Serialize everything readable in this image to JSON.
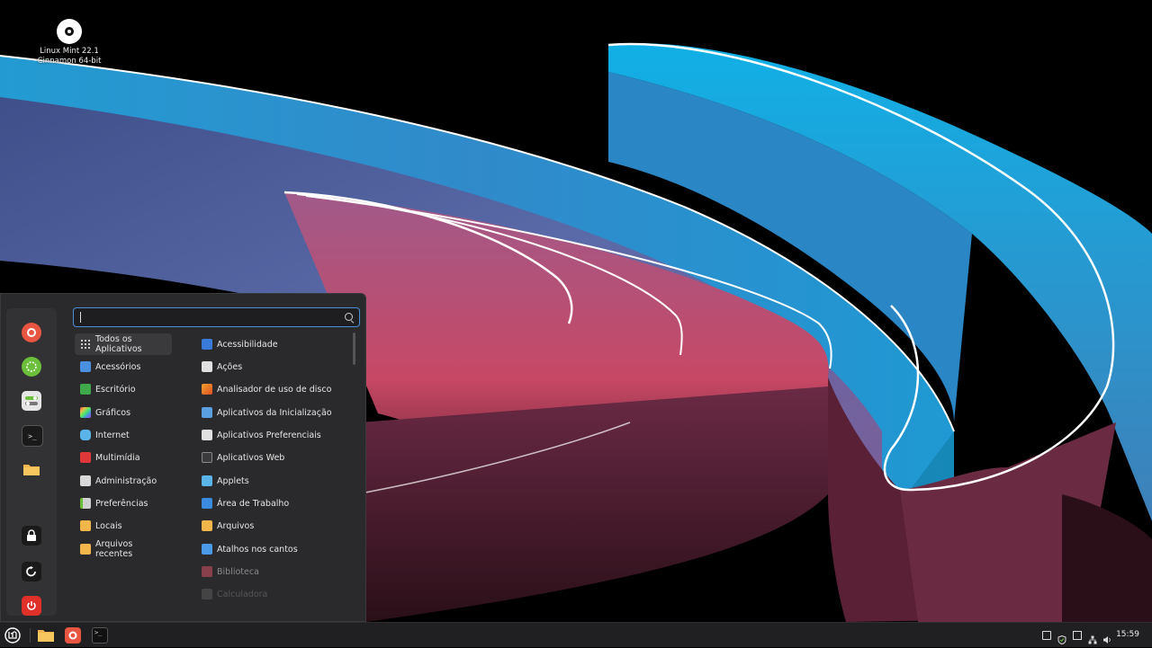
{
  "desktop": {
    "icon_line1": "Linux Mint 22.1",
    "icon_line2": "Cinnamon 64-bit"
  },
  "menu": {
    "search": {
      "value": "",
      "placeholder": ""
    },
    "favorites": [
      {
        "name": "firefox",
        "icon": "firefox-icon"
      },
      {
        "name": "software-manager",
        "icon": "mint-software-icon"
      },
      {
        "name": "settings",
        "icon": "toggles-icon"
      },
      {
        "name": "terminal",
        "icon": "terminal-icon"
      },
      {
        "name": "files",
        "icon": "folder-icon"
      },
      {
        "name": "lock",
        "icon": "lock-icon"
      },
      {
        "name": "logout",
        "icon": "logout-icon"
      },
      {
        "name": "shutdown",
        "icon": "power-icon"
      }
    ],
    "categories": [
      {
        "label": "Todos os Aplicativos",
        "icon": "grid-icon"
      },
      {
        "label": "Acessórios",
        "icon": "accessories-icon"
      },
      {
        "label": "Escritório",
        "icon": "office-icon"
      },
      {
        "label": "Gráficos",
        "icon": "graphics-icon"
      },
      {
        "label": "Internet",
        "icon": "internet-icon"
      },
      {
        "label": "Multimídia",
        "icon": "multimedia-icon"
      },
      {
        "label": "Administração",
        "icon": "administration-icon"
      },
      {
        "label": "Preferências",
        "icon": "preferences-icon"
      },
      {
        "label": "Locais",
        "icon": "folder-icon"
      },
      {
        "label": "Arquivos recentes",
        "icon": "recent-files-icon"
      }
    ],
    "apps": [
      {
        "label": "Acessibilidade",
        "icon": "accessibility-icon"
      },
      {
        "label": "Ações",
        "icon": "actions-icon"
      },
      {
        "label": "Analisador de uso de disco",
        "icon": "disk-usage-icon"
      },
      {
        "label": "Aplicativos da Inicialização",
        "icon": "startup-apps-icon"
      },
      {
        "label": "Aplicativos Preferenciais",
        "icon": "preferred-apps-icon"
      },
      {
        "label": "Aplicativos Web",
        "icon": "web-apps-icon"
      },
      {
        "label": "Applets",
        "icon": "applets-icon"
      },
      {
        "label": "Área de Trabalho",
        "icon": "desktop-icon"
      },
      {
        "label": "Arquivos",
        "icon": "folder-icon"
      },
      {
        "label": "Atalhos nos cantos",
        "icon": "hot-corners-icon"
      },
      {
        "label": "Biblioteca",
        "icon": "library-icon"
      },
      {
        "label": "Calculadora",
        "icon": "calculator-icon"
      }
    ]
  },
  "taskbar": {
    "clock": "15:59",
    "launchers": [
      {
        "name": "files",
        "icon": "folder-icon"
      },
      {
        "name": "firefox",
        "icon": "firefox-icon"
      },
      {
        "name": "terminal",
        "icon": "terminal-icon"
      }
    ]
  },
  "colors": {
    "accent": "#4a90d9",
    "menu_bg": "#2a2a2c",
    "taskbar_bg": "#202022"
  }
}
